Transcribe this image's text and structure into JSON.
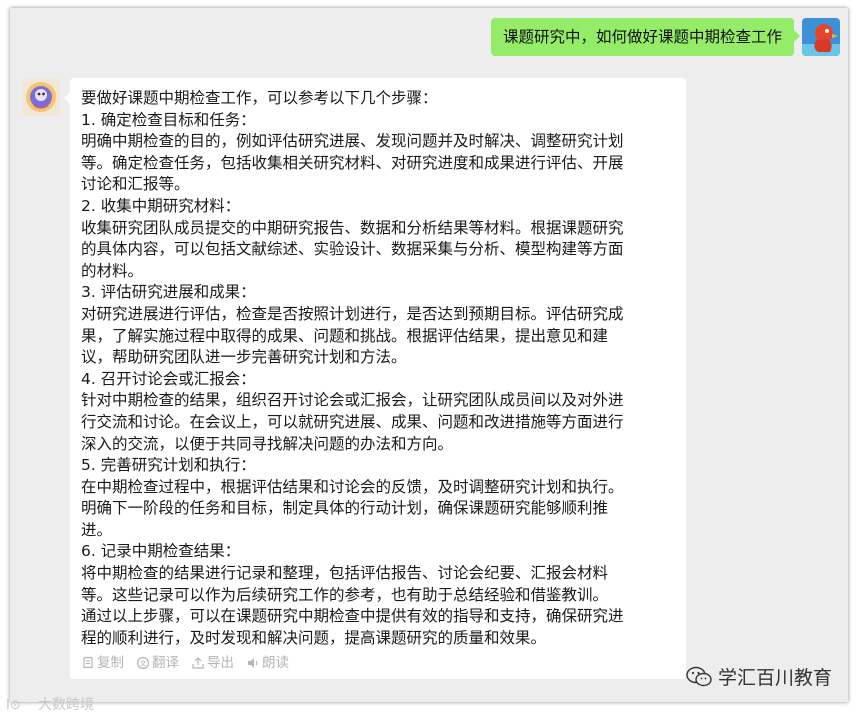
{
  "user_message": {
    "text": "课题研究中，如何做好课题中期检查工作"
  },
  "bot_message": {
    "lines": [
      "要做好课题中期检查工作，可以参考以下几个步骤：",
      "1. 确定检查目标和任务：",
      "明确中期检查的目的，例如评估研究进展、发现问题并及时解决、调整研究计划",
      "等。确定检查任务，包括收集相关研究材料、对研究进度和成果进行评估、开展",
      "讨论和汇报等。",
      "2. 收集中期研究材料：",
      "收集研究团队成员提交的中期研究报告、数据和分析结果等材料。根据课题研究",
      "的具体内容，可以包括文献综述、实验设计、数据采集与分析、模型构建等方面",
      "的材料。",
      "3. 评估研究进展和成果：",
      "对研究进展进行评估，检查是否按照计划进行，是否达到预期目标。评估研究成",
      "果，了解实施过程中取得的成果、问题和挑战。根据评估结果，提出意见和建",
      "议，帮助研究团队进一步完善研究计划和方法。",
      "4. 召开讨论会或汇报会：",
      "针对中期检查的结果，组织召开讨论会或汇报会，让研究团队成员间以及对外进",
      "行交流和讨论。在会议上，可以就研究进展、成果、问题和改进措施等方面进行",
      "深入的交流，以便于共同寻找解决问题的办法和方向。",
      "5. 完善研究计划和执行：",
      "在中期检查过程中，根据评估结果和讨论会的反馈，及时调整研究计划和执行。",
      "明确下一阶段的任务和目标，制定具体的行动计划，确保课题研究能够顺利推",
      "进。",
      "6. 记录中期检查结果：",
      "将中期检查的结果进行记录和整理，包括评估报告、讨论会纪要、汇报会材料",
      "等。这些记录可以作为后续研究工作的参考，也有助于总结经验和借鉴教训。",
      "通过以上步骤，可以在课题研究中期检查中提供有效的指导和支持，确保研究进",
      "程的顺利进行，及时发现和解决问题，提高课题研究的质量和效果。"
    ],
    "actions": {
      "copy": "复制",
      "translate": "翻译",
      "export": "导出",
      "read_aloud": "朗读"
    }
  },
  "watermarks": {
    "right": "学汇百川教育",
    "left": "大数跨境"
  },
  "colors": {
    "user_bubble": "#95ec69",
    "bot_bubble": "#ffffff",
    "background": "#ededed",
    "action_text": "#b5b5b5"
  },
  "icons": [
    "user-avatar-icon",
    "bot-avatar-icon",
    "copy-icon",
    "translate-icon",
    "export-icon",
    "speaker-icon",
    "wechat-icon",
    "brand-logo-icon"
  ]
}
